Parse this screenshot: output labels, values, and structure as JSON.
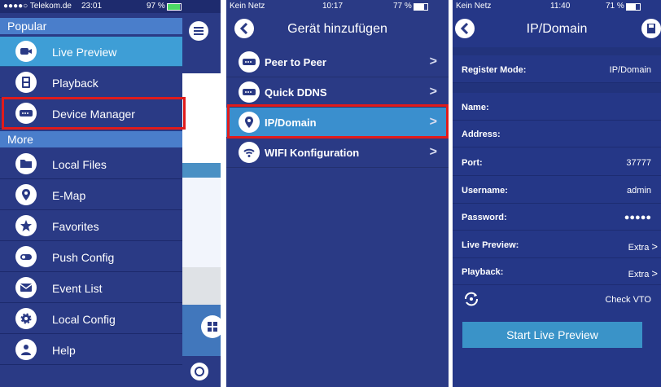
{
  "panel1": {
    "status": {
      "carrier": "●●●●○ Telekom.de",
      "time": "23:01",
      "battery": "97 %"
    },
    "sections": [
      "Popular",
      "More"
    ],
    "items": [
      {
        "label": "Live Preview",
        "icon": "camera-icon"
      },
      {
        "label": "Playback",
        "icon": "film-icon"
      },
      {
        "label": "Device Manager",
        "icon": "device-icon"
      },
      {
        "label": "Local Files",
        "icon": "folder-icon"
      },
      {
        "label": "E-Map",
        "icon": "map-pin-icon"
      },
      {
        "label": "Favorites",
        "icon": "star-icon"
      },
      {
        "label": "Push Config",
        "icon": "toggle-icon"
      },
      {
        "label": "Event List",
        "icon": "envelope-icon"
      },
      {
        "label": "Local Config",
        "icon": "gear-icon"
      },
      {
        "label": "Help",
        "icon": "help-person-icon"
      }
    ]
  },
  "panel2": {
    "status": {
      "carrier": "Kein Netz",
      "time": "10:17",
      "battery": "77 %"
    },
    "title": "Gerät hinzufügen",
    "items": [
      {
        "label": "Peer to Peer"
      },
      {
        "label": "Quick DDNS"
      },
      {
        "label": "IP/Domain"
      },
      {
        "label": "WIFI Konfiguration"
      }
    ]
  },
  "panel3": {
    "status": {
      "carrier": "Kein Netz",
      "time": "11:40",
      "battery": "71 %"
    },
    "title": "IP/Domain",
    "fields": {
      "register_mode": {
        "label": "Register Mode:",
        "value": "IP/Domain"
      },
      "name": {
        "label": "Name:",
        "value": ""
      },
      "address": {
        "label": "Address:",
        "value": ""
      },
      "port": {
        "label": "Port:",
        "value": "37777"
      },
      "username": {
        "label": "Username:",
        "value": "admin"
      },
      "password": {
        "label": "Password:",
        "value": "●●●●●"
      },
      "live_preview": {
        "label": "Live Preview:",
        "value": "Extra"
      },
      "playback": {
        "label": "Playback:",
        "value": "Extra"
      }
    },
    "check_vto": "Check VTO",
    "start_button": "Start Live Preview"
  },
  "colors": {
    "highlight": "#e01b1b",
    "active_item": "#3e9ed6",
    "section_header": "#4a7ecb",
    "panel_bg": "#2a3a85"
  }
}
